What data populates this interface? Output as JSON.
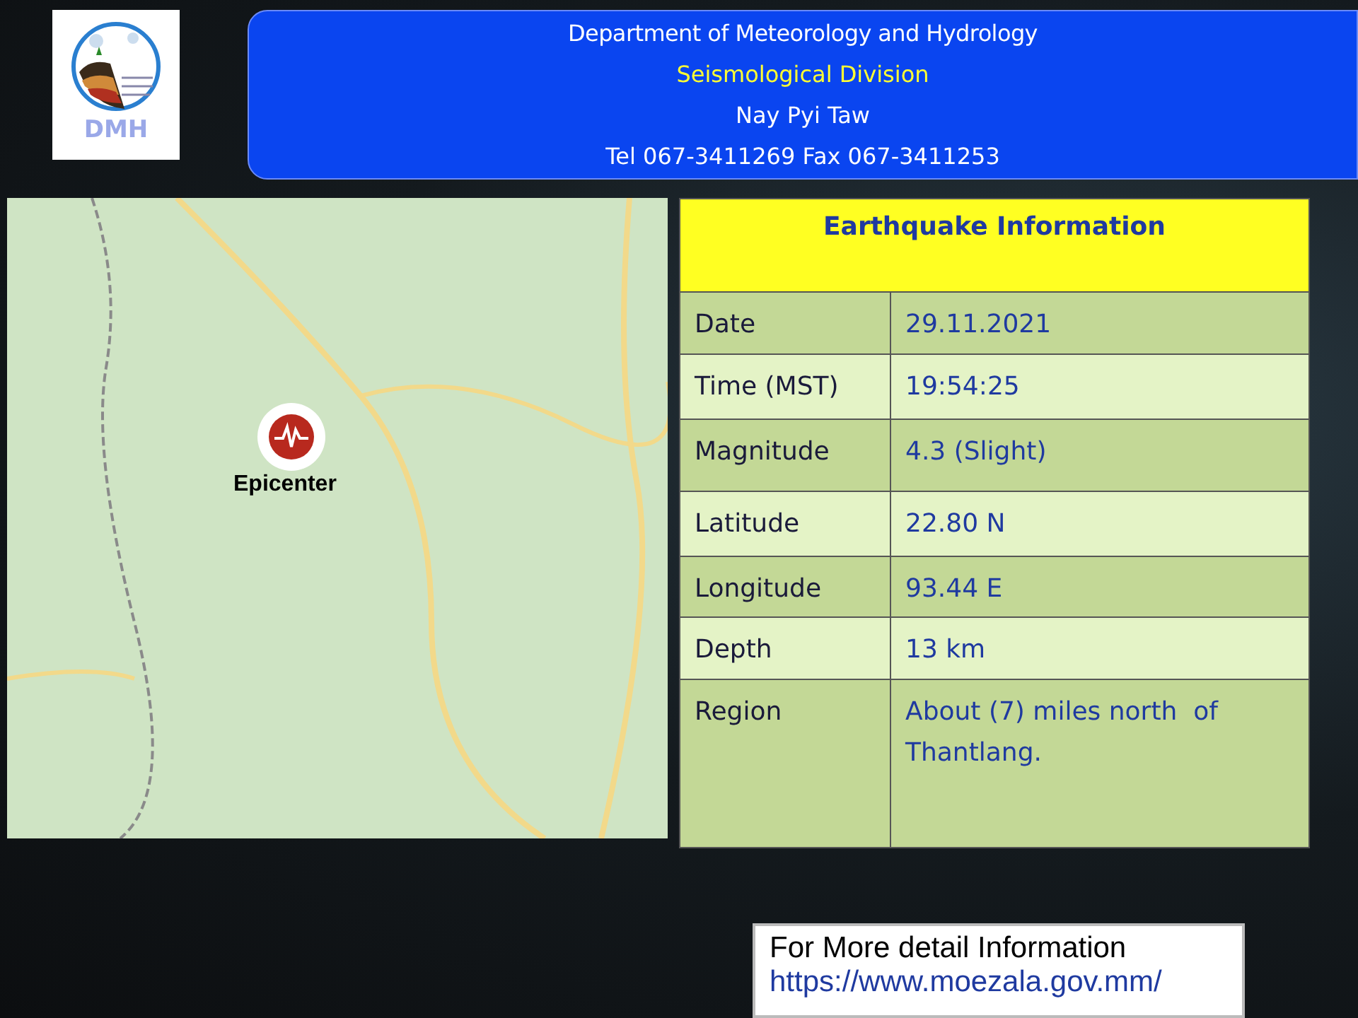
{
  "logo": {
    "text": "DMH"
  },
  "header": {
    "lines": [
      {
        "text": "Department of Meteorology and Hydrology",
        "kind": "title"
      },
      {
        "text": "Seismological Division",
        "kind": "highlight"
      },
      {
        "text": "Nay Pyi Taw",
        "kind": "plain"
      },
      {
        "text": "Tel 067-3411269 Fax 067-3411253",
        "kind": "plain"
      }
    ]
  },
  "map": {
    "marker_label": "Epicenter"
  },
  "table": {
    "title": "Earthquake Information",
    "rows": [
      {
        "label": "Date",
        "value": "29.11.2021"
      },
      {
        "label": "Time (MST)",
        "value": "19:54:25"
      },
      {
        "label": "Magnitude",
        "value": "4.3 (Slight)"
      },
      {
        "label": "Latitude",
        "value": "22.80 N"
      },
      {
        "label": "Longitude",
        "value": "93.44 E"
      },
      {
        "label": "Depth",
        "value": "13 km"
      },
      {
        "label": "Region",
        "value": "About (7) miles north  of Thantlang."
      }
    ]
  },
  "footer": {
    "text": "For More detail Information",
    "link": "https://www.moezala.gov.mm/"
  }
}
